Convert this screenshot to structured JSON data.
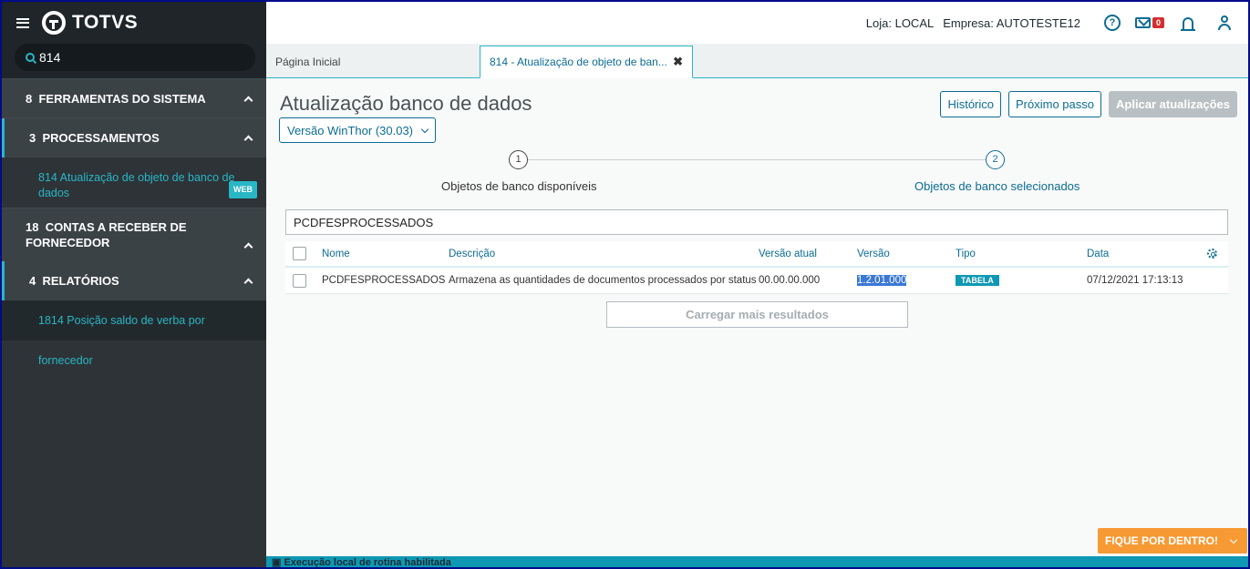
{
  "brand": {
    "name": "TOTVS"
  },
  "sidebar": {
    "search_value": "814",
    "groups": [
      {
        "number": "8",
        "label": "FERRAMENTAS DO SISTEMA"
      },
      {
        "number": "3",
        "label": "PROCESSAMENTOS",
        "items": [
          {
            "label": "814  Atualização de objeto de banco de dados",
            "badge": "WEB"
          }
        ]
      },
      {
        "number": "18",
        "label": "CONTAS A RECEBER DE FORNECEDOR"
      },
      {
        "number": "4",
        "label": "RELATÓRIOS",
        "items": [
          {
            "label": "1814  Posição saldo de verba por fornecedor"
          }
        ]
      }
    ]
  },
  "topbar": {
    "loja": "Loja: LOCAL",
    "empresa": "Empresa: AUTOTESTE12",
    "help_glyph": "?",
    "mail_count": "0"
  },
  "tabs": [
    {
      "label": "Página Inicial"
    },
    {
      "label": "814 - Atualização de objeto de ban...",
      "close": "✖"
    }
  ],
  "page": {
    "title": "Atualização banco de dados",
    "version_select": "Versão WinThor (30.03)",
    "buttons": {
      "historico": "Histórico",
      "proximo": "Próximo passo",
      "aplicar": "Aplicar atualizações"
    }
  },
  "stepper": [
    {
      "number": "1",
      "label": "Objetos de banco disponíveis"
    },
    {
      "number": "2",
      "label": "Objetos de banco selecionados"
    }
  ],
  "filter": {
    "value": "PCDFESPROCESSADOS"
  },
  "table": {
    "columns": [
      "Nome",
      "Descrição",
      "Versão atual",
      "Versão",
      "Tipo",
      "Data"
    ],
    "rows": [
      {
        "nome": "PCDFESPROCESSADOS",
        "descricao": "Armazena as quantidades de documentos processados por status",
        "versao_atual": "00.00.00.000",
        "versao": "1.2.01.000",
        "tipo": "TABELA",
        "data": "07/12/2021 17:13:13"
      }
    ],
    "load_more": "Carregar mais resultados"
  },
  "footer": {
    "status": "Execução local de rotina habilitada",
    "fique": "FIQUE POR DENTRO!"
  }
}
